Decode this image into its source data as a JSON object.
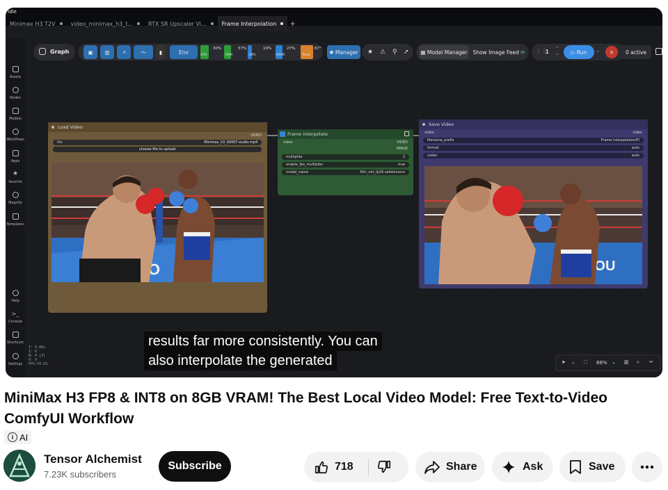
{
  "app": {
    "status": "Idle",
    "tabs": [
      {
        "label": "Minimax H3 T2V",
        "active": false
      },
      {
        "label": "video_minimax_h3_t...",
        "active": false
      },
      {
        "label": "RTX SR Upscaler Vi...",
        "active": false
      },
      {
        "label": "Frame Interpolation",
        "active": true
      }
    ],
    "sidebar": [
      "Assets",
      "Nodes",
      "Models",
      "Workflows",
      "Apps",
      "favorite",
      "Magnify",
      "Templates"
    ],
    "sidebar_bottom": [
      "Help",
      "Console",
      "Shortcuts",
      "Settings"
    ],
    "stats": [
      "T: 0.00s",
      "I: 0",
      "N: 4 [3]",
      "V: 9",
      "FPS:74.63"
    ],
    "toolbar": {
      "graph_label": "Graph",
      "env_label": "Env",
      "meters": [
        {
          "pct": "0%",
          "label": "CPU",
          "color": "#2e9e3a"
        },
        {
          "pct": "30%",
          "label": "RAM",
          "color": "#2e9e3a"
        },
        {
          "pct": "57%",
          "label": "GPU",
          "color": "#2e7fd1"
        },
        {
          "pct": "10%",
          "label": "VRAM",
          "color": "#2e7fd1"
        },
        {
          "pct": "27%",
          "label": "Temp",
          "color": "#d9822b"
        },
        {
          "pct": "67°",
          "label": "",
          "color": "#d9822b"
        }
      ],
      "manager_label": "Manager",
      "model_manager_label": "Model Manager",
      "show_image_feed_label": "Show Image Feed",
      "queue_count": "1",
      "run_label": "Run",
      "active_label": "0 active"
    },
    "nodes": {
      "load_video": {
        "title": "Load Video",
        "out": "VIDEO",
        "file_key": "file",
        "file_value": "Minimax_h3_00007-audio.mp4",
        "upload": "choose file to upload"
      },
      "frame_interpolate": {
        "title": "Frame Interpolate",
        "in": "video",
        "out1": "VIDEO",
        "out2": "IMAGE",
        "rows": [
          {
            "k": "multiplier",
            "v": "2"
          },
          {
            "k": "enable_fps_multiplier",
            "v": "true"
          },
          {
            "k": "model_name",
            "v": "film_net_fp16.safetensors"
          }
        ]
      },
      "save_video": {
        "title": "Save Video",
        "in": "video",
        "out": "video",
        "rows": [
          {
            "k": "filename_prefix",
            "v": "Frame Interpolation/FI"
          },
          {
            "k": "format",
            "v": "auto"
          },
          {
            "k": "codec",
            "v": "auto"
          }
        ]
      }
    },
    "zoom": "88%"
  },
  "caption": {
    "line1": "results far more consistently. You can",
    "line2": "also interpolate the generated"
  },
  "video": {
    "title": "MiniMax H3 FP8 & INT8 on 8GB VRAM! The Best Local Video Model: Free Text-to-Video ComfyUI Workflow",
    "ai_badge": "AI"
  },
  "channel": {
    "name": "Tensor Alchemist",
    "subscribers": "7.23K subscribers",
    "subscribe_label": "Subscribe"
  },
  "actions": {
    "likes": "718",
    "share": "Share",
    "ask": "Ask",
    "save": "Save"
  }
}
